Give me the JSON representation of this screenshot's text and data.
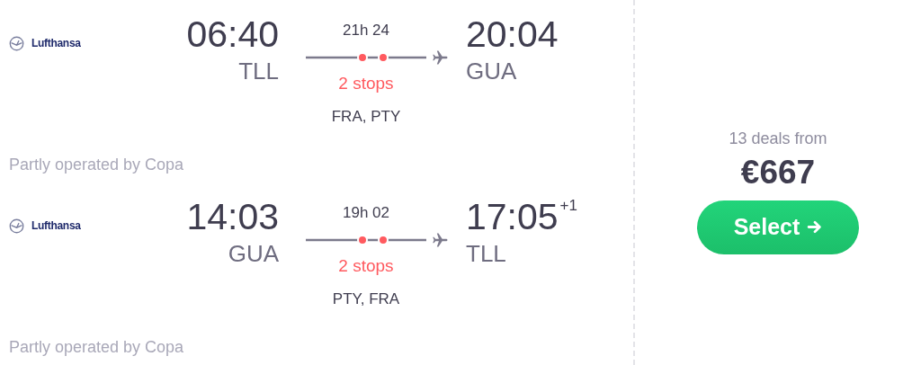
{
  "legs": [
    {
      "airline": "Lufthansa",
      "departure_time": "06:40",
      "departure_airport": "TLL",
      "duration": "21h 24",
      "stops_label": "2 stops",
      "via": "FRA, PTY",
      "arrival_time": "20:04",
      "arrival_airport": "GUA",
      "operator_note": "Partly operated by Copa"
    },
    {
      "airline": "Lufthansa",
      "departure_time": "14:03",
      "departure_airport": "GUA",
      "duration": "19h 02",
      "stops_label": "2 stops",
      "via": "PTY, FRA",
      "arrival_time": "17:05",
      "arrival_day_offset": "+1",
      "arrival_airport": "TLL",
      "operator_note": "Partly operated by Copa"
    }
  ],
  "deals": {
    "summary": "13 deals from",
    "price": "€667",
    "button": "Select"
  }
}
